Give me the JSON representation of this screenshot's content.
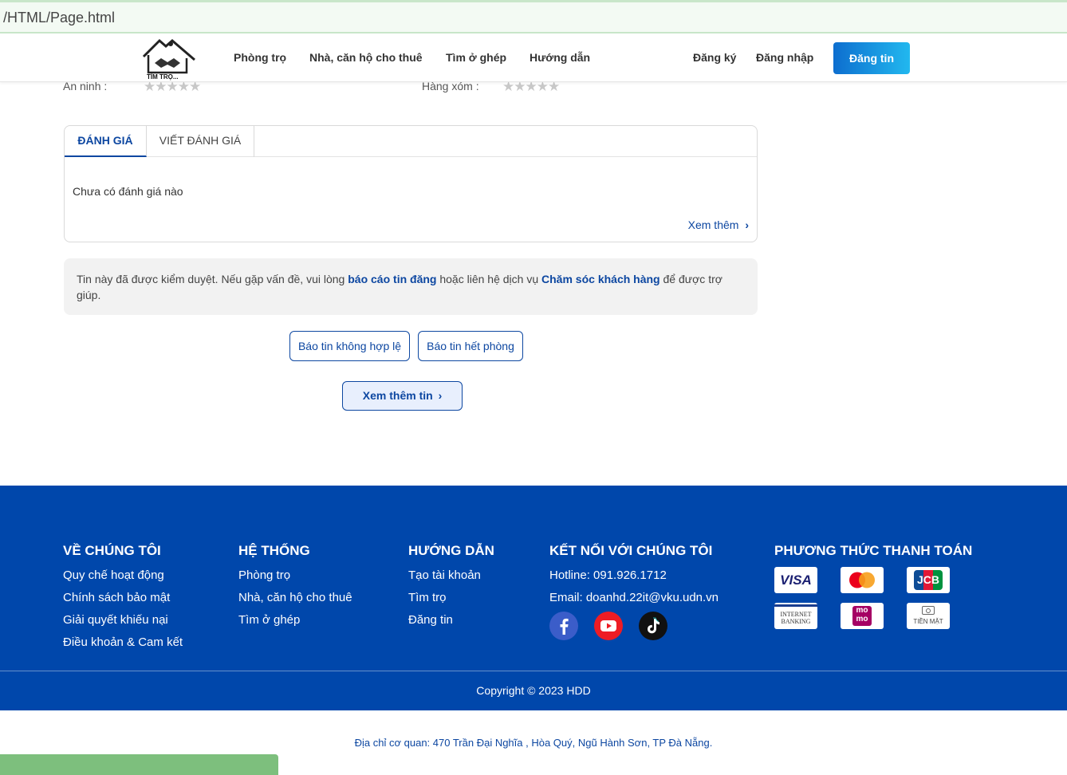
{
  "browser": {
    "url_text": "/HTML/Page.html"
  },
  "header": {
    "logo_text": "TÌM TRỌ...",
    "nav": [
      "Phòng trọ",
      "Nhà, căn hộ cho thuê",
      "Tìm ở ghép",
      "Hướng dẫn"
    ],
    "register": "Đăng ký",
    "login": "Đăng nhập",
    "post_button": "Đăng tin"
  },
  "ratings": {
    "security_label": "An ninh :",
    "neighbors_label": "Hàng xóm :",
    "security_stars": 0,
    "neighbors_stars": 0,
    "max_stars": 5
  },
  "reviews": {
    "tabs": [
      "ĐÁNH GIÁ",
      "VIẾT ĐÁNH GIÁ"
    ],
    "empty_message": "Chưa có đánh giá nào",
    "see_more": "Xem thêm"
  },
  "notice": {
    "text_1": "Tin này đã được kiểm duyệt. Nếu gặp vấn đề, vui lòng",
    "link_report": "báo cáo tin đăng",
    "text_2": "hoặc liên hệ dịch vụ",
    "link_support": "Chăm sóc khách hàng",
    "text_3": "để được trợ giúp."
  },
  "actions": {
    "report_invalid": "Báo tin không hợp lệ",
    "report_full": "Báo tin hết phòng",
    "more_posts": "Xem thêm tin"
  },
  "footer": {
    "about": {
      "title": "VỀ CHÚNG TÔI",
      "links": [
        "Quy chế hoạt động",
        "Chính sách bảo mật",
        "Giải quyết khiếu nại",
        "Điều khoản & Cam kết"
      ]
    },
    "system": {
      "title": "HỆ THỐNG",
      "links": [
        "Phòng trọ",
        "Nhà, căn hộ cho thuê",
        "Tìm ở ghép"
      ]
    },
    "guide": {
      "title": "HƯỚNG DẪN",
      "links": [
        "Tạo tài khoản",
        "Tìm trọ",
        "Đăng tin"
      ]
    },
    "connect": {
      "title": "KẾT NỐI VỚI CHÚNG TÔI",
      "hotline": "Hotline: 091.926.1712",
      "email": "Email: doanhd.22it@vku.udn.vn",
      "socials": [
        "facebook-icon",
        "youtube-icon",
        "tiktok-icon"
      ]
    },
    "payment": {
      "title": "PHƯƠNG THỨC THANH TOÁN",
      "visa": "VISA",
      "jcb": "JCB",
      "banking": [
        "INTERNET",
        "BANKING"
      ],
      "momo": [
        "mo",
        "mo"
      ],
      "cash": "TIỀN MẶT"
    },
    "copyright": "Copyright © 2023 HDD",
    "background": "#0047ab"
  },
  "address": "Địa chỉ cơ quan: 470 Trần Đại Nghĩa , Hòa Quý, Ngũ Hành Sơn, TP Đà Nẵng.",
  "colors": {
    "primary": "#0d47a1",
    "accent_gradient_start": "#0d6ecf",
    "accent_gradient_end": "#22b8ef"
  }
}
